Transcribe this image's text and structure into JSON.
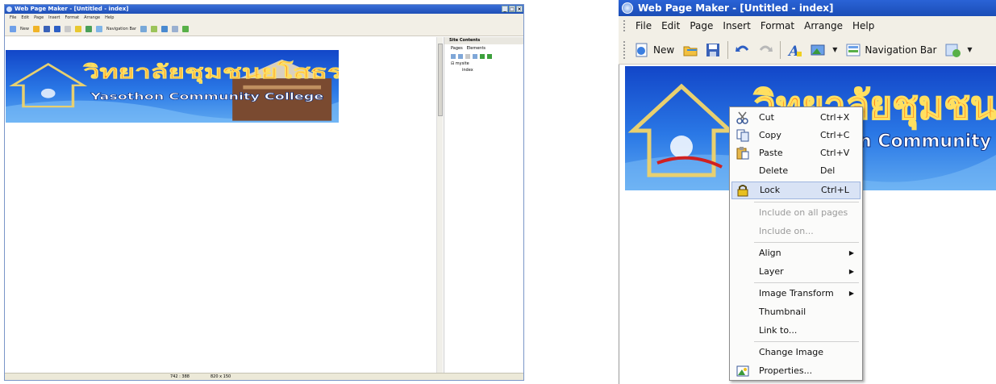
{
  "left_window": {
    "title": "Web Page Maker - [Untitled - index]",
    "window_buttons": [
      "_",
      "□",
      "×"
    ],
    "menu": [
      "File",
      "Edit",
      "Page",
      "Insert",
      "Format",
      "Arrange",
      "Help"
    ],
    "toolbar": {
      "new_label": "New",
      "navbar_label": "Navigation Bar"
    },
    "site_panel": {
      "title": "Site Contents",
      "tabs": [
        "Pages",
        "Elements"
      ],
      "tree_root": "mysite",
      "tree_child": "index"
    },
    "banner": {
      "thai_text": "วิทยาลัยชุมชนยโสธร",
      "english_text": "Yasothon Community College"
    },
    "status": {
      "cursor": "742 : 388",
      "size": "820 x 150"
    }
  },
  "right_window": {
    "title": "Web Page Maker - [Untitled - index]",
    "menu": [
      "File",
      "Edit",
      "Page",
      "Insert",
      "Format",
      "Arrange",
      "Help"
    ],
    "toolbar": {
      "new_label": "New",
      "navbar_label": "Navigation Bar"
    },
    "banner": {
      "thai_text": "วิทยาลัยชุมชน",
      "english_text": "n Community"
    }
  },
  "context_menu": {
    "items": [
      {
        "label": "Cut",
        "shortcut": "Ctrl+X",
        "icon": "scissors-icon",
        "enabled": true
      },
      {
        "label": "Copy",
        "shortcut": "Ctrl+C",
        "icon": "copy-icon",
        "enabled": true
      },
      {
        "label": "Paste",
        "shortcut": "Ctrl+V",
        "icon": "paste-icon",
        "enabled": true
      },
      {
        "label": "Delete",
        "shortcut": "Del",
        "icon": "",
        "enabled": true
      },
      {
        "label": "Lock",
        "shortcut": "Ctrl+L",
        "icon": "padlock-icon",
        "enabled": true,
        "highlighted": true
      },
      {
        "label": "Include on all pages",
        "shortcut": "",
        "enabled": false
      },
      {
        "label": "Include on...",
        "shortcut": "",
        "enabled": false
      },
      {
        "label": "Align",
        "submenu": true,
        "enabled": true
      },
      {
        "label": "Layer",
        "submenu": true,
        "enabled": true
      },
      {
        "label": "Image Transform",
        "submenu": true,
        "enabled": true
      },
      {
        "label": "Thumbnail",
        "enabled": true
      },
      {
        "label": "Link to...",
        "enabled": true
      },
      {
        "label": "Change Image",
        "enabled": true
      },
      {
        "label": "Properties...",
        "icon": "properties-icon",
        "enabled": true
      }
    ]
  },
  "colors": {
    "titlebar": "#1e4fb6",
    "menu_bg": "#f2efe6",
    "highlight": "#d9e3f5",
    "banner_sky": "#1f5fd6",
    "banner_thai_text": "#ff7a10"
  }
}
